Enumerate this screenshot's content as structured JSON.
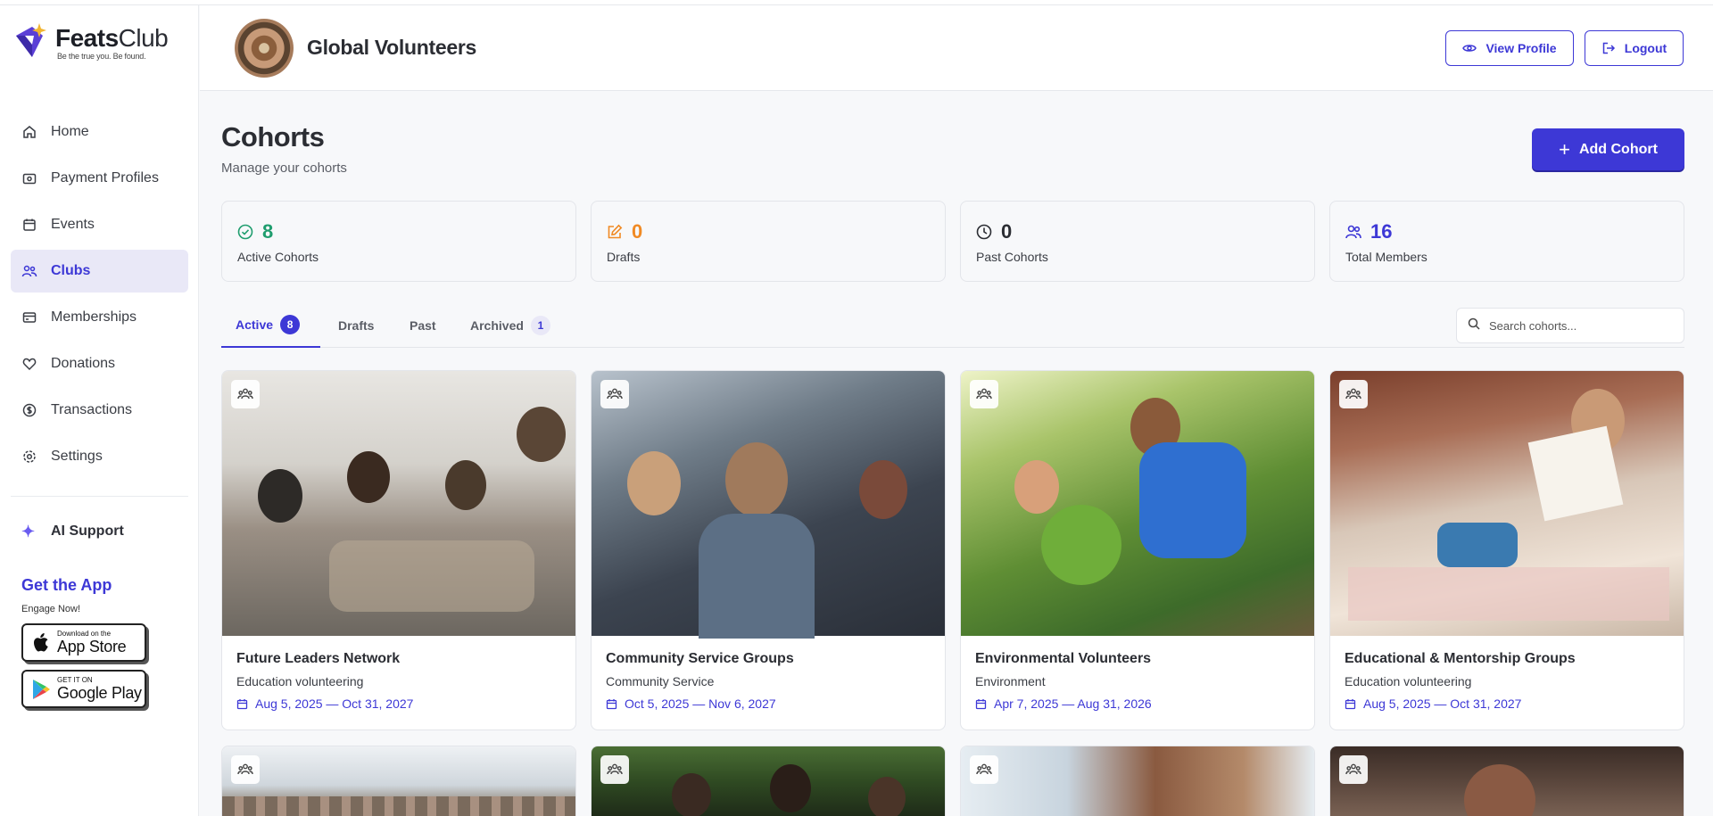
{
  "brand": {
    "name_bold": "Feats",
    "name_light": "Club",
    "tagline": "Be the true you. Be found."
  },
  "sidebar": {
    "items": [
      {
        "label": "Home",
        "icon": "home-icon"
      },
      {
        "label": "Payment Profiles",
        "icon": "payment-icon"
      },
      {
        "label": "Events",
        "icon": "calendar-icon"
      },
      {
        "label": "Clubs",
        "icon": "users-icon",
        "active": true
      },
      {
        "label": "Memberships",
        "icon": "card-icon"
      },
      {
        "label": "Donations",
        "icon": "heart-icon"
      },
      {
        "label": "Transactions",
        "icon": "dollar-icon"
      },
      {
        "label": "Settings",
        "icon": "gear-icon"
      }
    ],
    "ai_support": "AI Support",
    "get_app": "Get the App",
    "engage": "Engage Now!",
    "app_store": {
      "small": "Download on the",
      "big": "App Store"
    },
    "google_play": {
      "small": "GET IT ON",
      "big": "Google Play"
    }
  },
  "header": {
    "org_name": "Global Volunteers",
    "view_profile": "View Profile",
    "logout": "Logout"
  },
  "page": {
    "title": "Cohorts",
    "subtitle": "Manage your cohorts",
    "add_button": "Add Cohort"
  },
  "stats": [
    {
      "value": "8",
      "label": "Active Cohorts",
      "color": "#1f9d6e",
      "icon": "check-circle-icon"
    },
    {
      "value": "0",
      "label": "Drafts",
      "color": "#f08a24",
      "icon": "edit-icon"
    },
    {
      "value": "0",
      "label": "Past Cohorts",
      "color": "#2b2d33",
      "icon": "clock-icon"
    },
    {
      "value": "16",
      "label": "Total Members",
      "color": "#3d38d6",
      "icon": "users-icon"
    }
  ],
  "tabs": [
    {
      "label": "Active",
      "count": "8"
    },
    {
      "label": "Drafts",
      "count": ""
    },
    {
      "label": "Past",
      "count": ""
    },
    {
      "label": "Archived",
      "count": "1"
    }
  ],
  "search": {
    "placeholder": "Search cohorts..."
  },
  "cohorts": [
    {
      "title": "Future Leaders Network",
      "category": "Education volunteering",
      "dates": "Aug 5, 2025 — Oct 31, 2027"
    },
    {
      "title": "Community Service Groups",
      "category": "Community Service",
      "dates": "Oct 5, 2025 — Nov 6, 2027"
    },
    {
      "title": "Environmental Volunteers",
      "category": "Environment",
      "dates": "Apr 7, 2025 — Aug 31, 2026"
    },
    {
      "title": "Educational & Mentorship Groups",
      "category": "Education volunteering",
      "dates": "Aug 5, 2025 — Oct 31, 2027"
    }
  ],
  "colors": {
    "accent": "#3d38d6",
    "active_nav_bg": "#e9e8f7"
  }
}
